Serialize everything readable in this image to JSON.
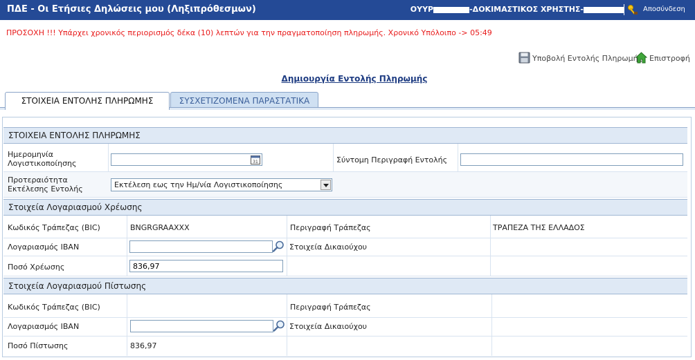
{
  "header": {
    "title": "ΠΔΕ - Οι Ετήσιες Δηλώσεις μου (Ληξιπρόθεσμων)",
    "user_prefix": "ΟΥΥΡ",
    "user_middle": "-ΔΟΚΙΜΑΣΤΙΚΟΣ ΧΡΗΣΤΗΣ-",
    "logout_label": "Αποσύνδεση"
  },
  "warning": "ΠΡΟΣΟΧΗ !!! Υπάρχει χρονικός περιορισμός δέκα (10) λεπτών για την πραγματοποίηση πληρωμής. Χρονικό Υπόλοιπο -> 05:49",
  "actions": {
    "submit_label": "Υποβολή Εντολής Πληρωμής",
    "back_label": "Επιστροφή"
  },
  "page_link": "Δημιουργία Εντολής Πληρωμής",
  "tabs": [
    {
      "label": "ΣΤΟΙΧΕΙΑ ΕΝΤΟΛΗΣ ΠΛΗΡΩΜΗΣ",
      "active": true
    },
    {
      "label": "ΣΥΣΧΕΤΙΖΟΜΕΝΑ ΠΑΡΑΣΤΑΤΙΚΑ",
      "active": false
    }
  ],
  "order_section": {
    "title": "ΣΤΟΙΧΕΙΑ ΕΝΤΟΛΗΣ ΠΛΗΡΩΜΗΣ",
    "date_label": "Ημερομηνία Λογιστικοποίησης",
    "date_value": "",
    "short_desc_label": "Σύντομη Περιγραφή Εντολής",
    "short_desc_value": "",
    "priority_label": "Προτεραιότητα Εκτέλεσης Εντολής",
    "priority_value": "Εκτέλεση εως την Ημ/νία Λογιστικοποίησης"
  },
  "debit_section": {
    "title": "Στοιχεία Λογαριασμού Χρέωσης",
    "bic_label": "Κωδικός Τράπεζας (BIC)",
    "bic_value": "BNGRGRAAXXX",
    "bank_desc_label": "Περιγραφή Τράπεζας",
    "bank_desc_value": "ΤΡΑΠΕΖΑ ΤΗΣ ΕΛΛΑΔΟΣ",
    "iban_label": "Λογαριασμός IBAN",
    "iban_value": "",
    "beneficiary_label": "Στοιχεία Δικαιούχου",
    "amount_label": "Ποσό Χρέωσης",
    "amount_value": "836,97"
  },
  "credit_section": {
    "title": "Στοιχεία Λογαριασμού Πίστωσης",
    "bic_label": "Κωδικός Τράπεζας (BIC)",
    "bic_value": "",
    "bank_desc_label": "Περιγραφή Τράπεζας",
    "iban_label": "Λογαριασμός IBAN",
    "iban_value": "",
    "beneficiary_label": "Στοιχεία Δικαιούχου",
    "amount_label": "Ποσό Πίστωσης",
    "amount_value": "836,97"
  },
  "icons": {
    "calendar": "calendar-icon",
    "search": "magnifier-icon",
    "logout": "keys-icon",
    "save": "floppy-disk-icon",
    "home": "home-icon"
  },
  "colors": {
    "topbar": "#244a96",
    "warning": "#e81b1b",
    "section_bg": "#dfe9f5"
  }
}
